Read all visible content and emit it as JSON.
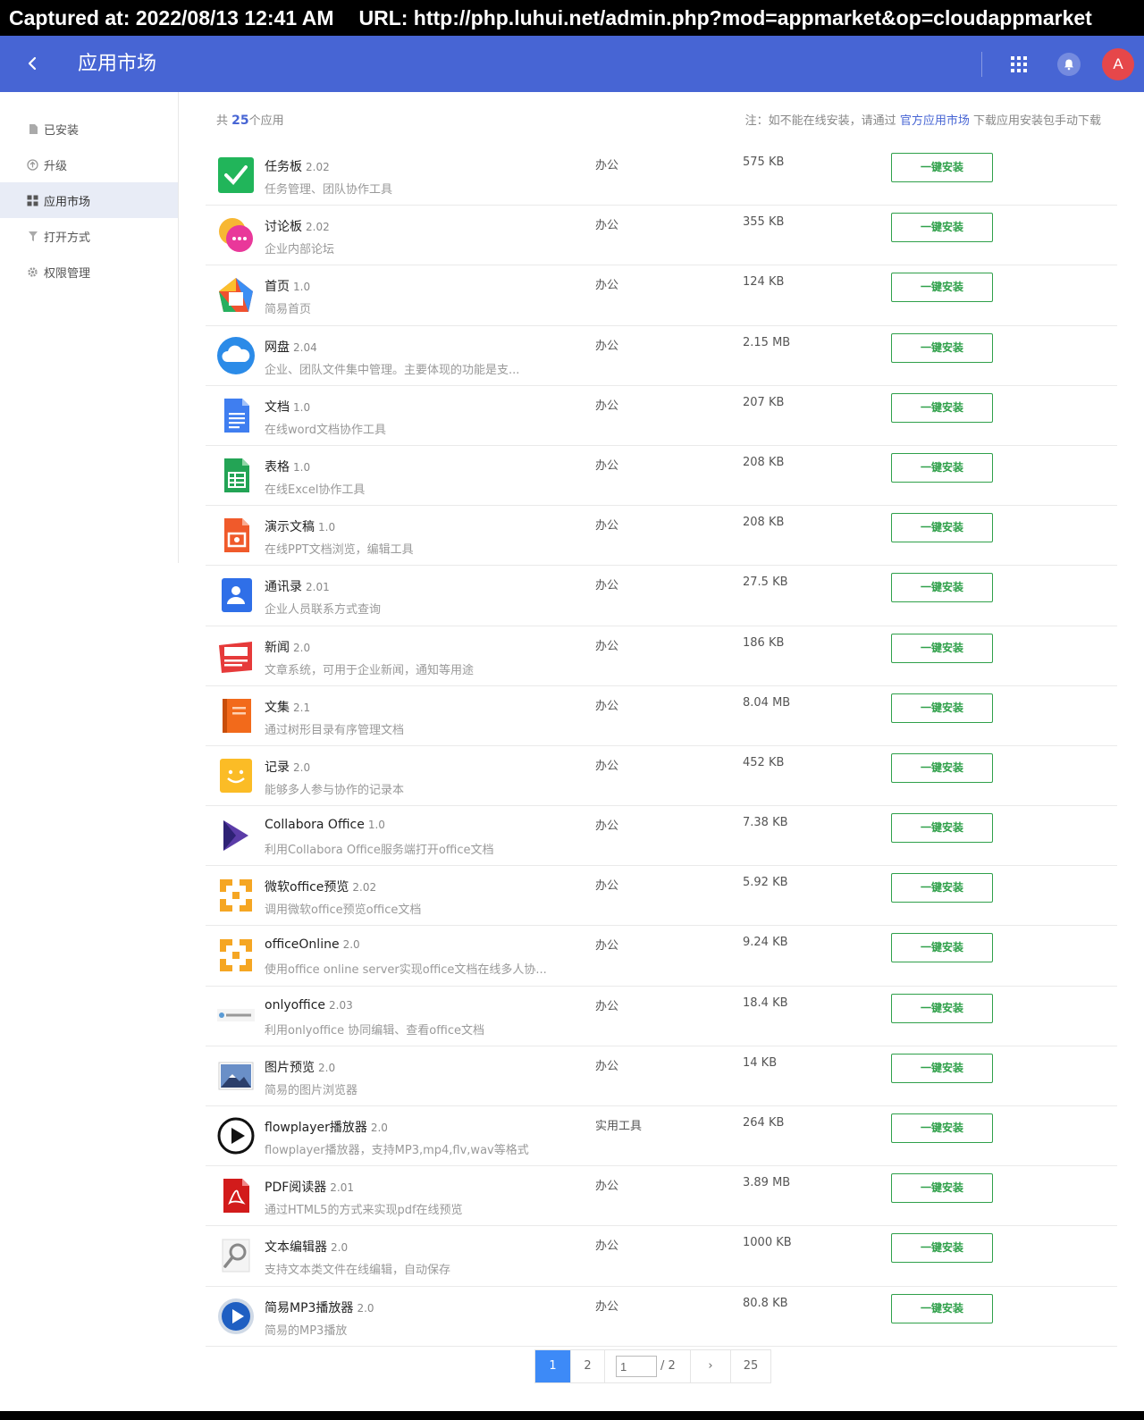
{
  "capture": {
    "captured_at": "Captured at: 2022/08/13 12:41 AM",
    "url": "URL: http://php.luhui.net/admin.php?mod=appmarket&op=cloudappmarket"
  },
  "header": {
    "title": "应用市场",
    "avatar_letter": "A",
    "brand_color": "#4765d4"
  },
  "sidebar": {
    "items": [
      {
        "label": "已安装",
        "icon": "file-icon"
      },
      {
        "label": "升级",
        "icon": "upgrade-icon"
      },
      {
        "label": "应用市场",
        "icon": "grid-icon",
        "active": true
      },
      {
        "label": "打开方式",
        "icon": "filter-icon"
      },
      {
        "label": "权限管理",
        "icon": "gear-icon"
      }
    ]
  },
  "summary": {
    "prefix": "共",
    "count": "25",
    "suffix": "个应用",
    "note_prefix": "注：如不能在线安装，请通过",
    "note_link": "官方应用市场",
    "note_suffix": "下载应用安装包手动下载"
  },
  "install_label": "一键安装",
  "apps": [
    {
      "name": "任务板",
      "version": "2.02",
      "desc": "任务管理、团队协作工具",
      "category": "办公",
      "size": "575 KB",
      "icon": "task-board-icon"
    },
    {
      "name": "讨论板",
      "version": "2.02",
      "desc": "企业内部论坛",
      "category": "办公",
      "size": "355 KB",
      "icon": "discussion-icon"
    },
    {
      "name": "首页",
      "version": "1.0",
      "desc": "简易首页",
      "category": "办公",
      "size": "124 KB",
      "icon": "home-icon"
    },
    {
      "name": "网盘",
      "version": "2.04",
      "desc": "企业、团队文件集中管理。主要体现的功能是支...",
      "category": "办公",
      "size": "2.15 MB",
      "icon": "cloud-icon"
    },
    {
      "name": "文档",
      "version": "1.0",
      "desc": "在线word文档协作工具",
      "category": "办公",
      "size": "207 KB",
      "icon": "document-icon"
    },
    {
      "name": "表格",
      "version": "1.0",
      "desc": "在线Excel协作工具",
      "category": "办公",
      "size": "208 KB",
      "icon": "spreadsheet-icon"
    },
    {
      "name": "演示文稿",
      "version": "1.0",
      "desc": "在线PPT文档浏览，编辑工具",
      "category": "办公",
      "size": "208 KB",
      "icon": "presentation-icon"
    },
    {
      "name": "通讯录",
      "version": "2.01",
      "desc": "企业人员联系方式查询",
      "category": "办公",
      "size": "27.5 KB",
      "icon": "contacts-icon"
    },
    {
      "name": "新闻",
      "version": "2.0",
      "desc": "文章系统，可用于企业新闻，通知等用途",
      "category": "办公",
      "size": "186 KB",
      "icon": "news-icon"
    },
    {
      "name": "文集",
      "version": "2.1",
      "desc": "通过树形目录有序管理文档",
      "category": "办公",
      "size": "8.04 MB",
      "icon": "book-icon"
    },
    {
      "name": "记录",
      "version": "2.0",
      "desc": "能够多人参与协作的记录本",
      "category": "办公",
      "size": "452 KB",
      "icon": "notes-icon"
    },
    {
      "name": "Collabora Office",
      "version": "1.0",
      "desc": "利用Collabora Office服务端打开office文档",
      "category": "办公",
      "size": "7.38 KB",
      "icon": "collabora-icon"
    },
    {
      "name": "微软office预览",
      "version": "2.02",
      "desc": "调用微软office预览office文档",
      "category": "办公",
      "size": "5.92 KB",
      "icon": "office-preview-icon"
    },
    {
      "name": "officeOnline",
      "version": "2.0",
      "desc": "使用office online server实现office文档在线多人协...",
      "category": "办公",
      "size": "9.24 KB",
      "icon": "office-online-icon"
    },
    {
      "name": "onlyoffice",
      "version": "2.03",
      "desc": "利用onlyoffice 协同编辑、查看office文档",
      "category": "办公",
      "size": "18.4 KB",
      "icon": "onlyoffice-icon"
    },
    {
      "name": "图片预览",
      "version": "2.0",
      "desc": "简易的图片浏览器",
      "category": "办公",
      "size": "14 KB",
      "icon": "image-preview-icon"
    },
    {
      "name": "flowplayer播放器",
      "version": "2.0",
      "desc": "flowplayer播放器，支持MP3,mp4,flv,wav等格式",
      "category": "实用工具",
      "size": "264 KB",
      "icon": "play-icon"
    },
    {
      "name": "PDF阅读器",
      "version": "2.01",
      "desc": "通过HTML5的方式来实现pdf在线预览",
      "category": "办公",
      "size": "3.89 MB",
      "icon": "pdf-icon"
    },
    {
      "name": "文本编辑器",
      "version": "2.0",
      "desc": "支持文本类文件在线编辑，自动保存",
      "category": "办公",
      "size": "1000 KB",
      "icon": "text-editor-icon"
    },
    {
      "name": "简易MP3播放器",
      "version": "2.0",
      "desc": "简易的MP3播放",
      "category": "办公",
      "size": "80.8 KB",
      "icon": "mp3-player-icon"
    }
  ],
  "pagination": {
    "page1": "1",
    "page2": "2",
    "jump_value": "1",
    "total_text": "/ 2",
    "next": "›",
    "last": "25"
  }
}
